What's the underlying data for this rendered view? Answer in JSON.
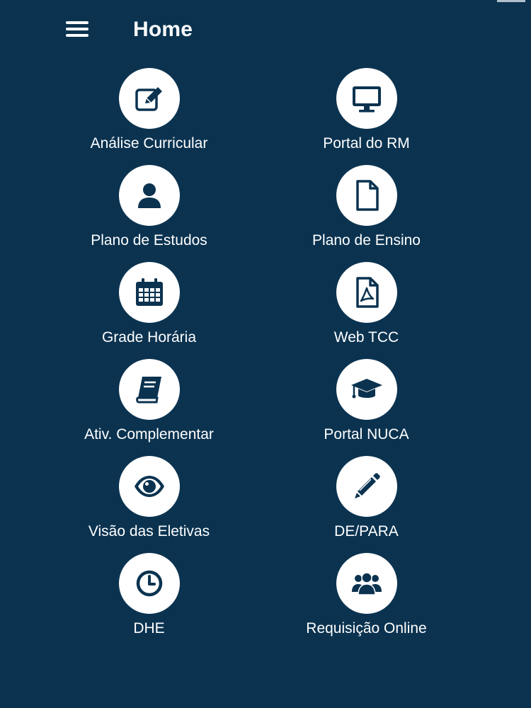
{
  "header": {
    "title": "Home",
    "menu_icon": "hamburger-menu-icon"
  },
  "colors": {
    "background": "#0b3350",
    "icon_circle": "#ffffff",
    "icon_glyph": "#0b3350",
    "text": "#ffffff"
  },
  "tiles": [
    {
      "label": "Análise Curricular",
      "icon": "edit-square-icon"
    },
    {
      "label": "Portal do RM",
      "icon": "monitor-icon"
    },
    {
      "label": "Plano de Estudos",
      "icon": "user-icon"
    },
    {
      "label": "Plano de Ensino",
      "icon": "document-icon"
    },
    {
      "label": "Grade Horária",
      "icon": "calendar-icon"
    },
    {
      "label": "Web TCC",
      "icon": "pdf-file-icon"
    },
    {
      "label": "Ativ. Complementar",
      "icon": "book-icon"
    },
    {
      "label": "Portal NUCA",
      "icon": "graduation-cap-icon"
    },
    {
      "label": "Visão das Eletivas",
      "icon": "eye-icon"
    },
    {
      "label": "DE/PARA",
      "icon": "pencil-icon"
    },
    {
      "label": "DHE",
      "icon": "clock-icon"
    },
    {
      "label": "Requisição Online",
      "icon": "users-group-icon"
    }
  ]
}
